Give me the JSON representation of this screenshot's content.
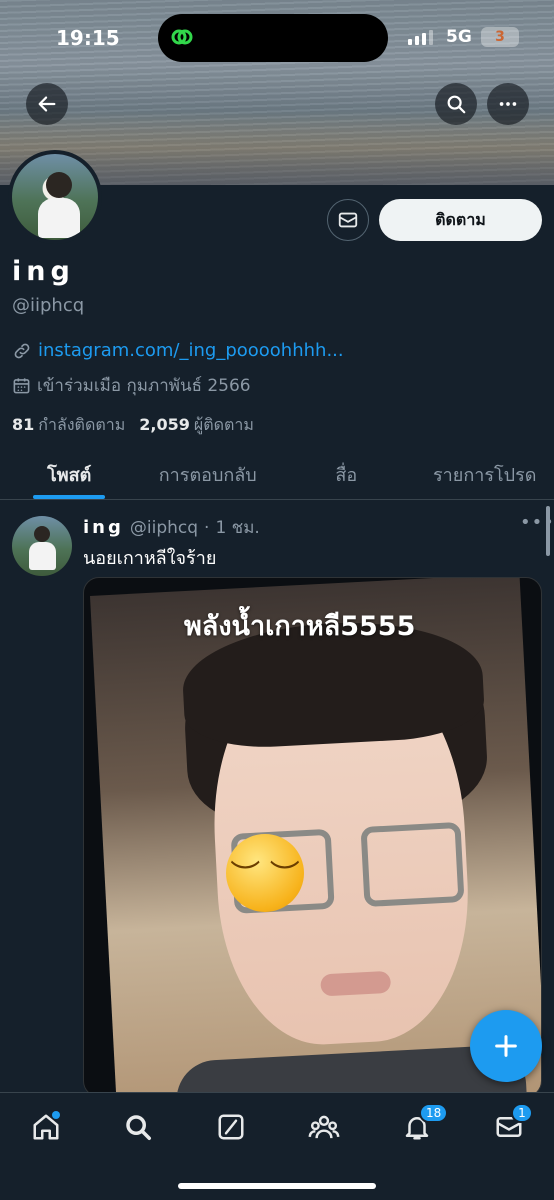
{
  "status_bar": {
    "time": "19:15",
    "network": "5G",
    "battery": "3"
  },
  "profile": {
    "display_name": "ing",
    "handle": "@iiphcq",
    "link": "instagram.com/_ing_poooohhhh...",
    "joined": "เข้าร่วมเมือ กุมภาพันธ์ 2566",
    "following_count": "81",
    "following_label": "กำลังติดตาม",
    "followers_count": "2,059",
    "followers_label": "ผู้ติดตาม",
    "follow_label": "ติดตาม"
  },
  "tabs": [
    {
      "label": "โพสต์",
      "active": true
    },
    {
      "label": "การตอบกลับ",
      "active": false
    },
    {
      "label": "สื่อ",
      "active": false
    },
    {
      "label": "รายการโปรด",
      "active": false
    }
  ],
  "post": {
    "name": "ing",
    "handle": "@iiphcq",
    "separator": "·",
    "time": "1 ชม.",
    "text": "นอยเกาหลีใจร้าย",
    "media_caption": "พลังน้ำเกาหลี5555",
    "emoji": "pensive-sleepy-emoji"
  },
  "bottom_nav": {
    "items": [
      {
        "name": "home-icon",
        "badge": ""
      },
      {
        "name": "search-icon",
        "badge": ""
      },
      {
        "name": "grok-icon",
        "badge": ""
      },
      {
        "name": "communities-icon",
        "badge": ""
      },
      {
        "name": "notifications-icon",
        "badge": "18"
      },
      {
        "name": "messages-icon",
        "badge": "1"
      }
    ]
  },
  "colors": {
    "background": "#15202b",
    "accent": "#1d9bf0",
    "muted": "#8b98a5"
  }
}
